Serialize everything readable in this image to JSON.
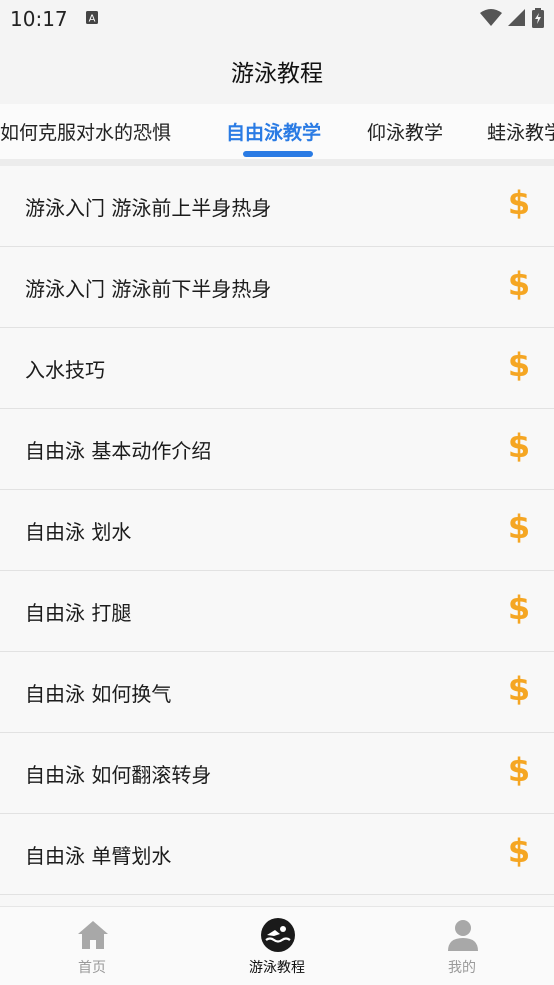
{
  "status_bar": {
    "time": "10:17",
    "icons": [
      "a-notification-icon",
      "wifi-icon",
      "signal-icon",
      "battery-charging-icon"
    ]
  },
  "header": {
    "title": "游泳教程"
  },
  "tabs": [
    {
      "label": "如何克服对水的恐惧",
      "active": false
    },
    {
      "label": "自由泳教学",
      "active": true
    },
    {
      "label": "仰泳教学",
      "active": false
    },
    {
      "label": "蛙泳教学",
      "active": false
    }
  ],
  "list": {
    "items": [
      {
        "title": "游泳入门 游泳前上半身热身",
        "icon": "dollar-icon"
      },
      {
        "title": "游泳入门 游泳前下半身热身",
        "icon": "dollar-icon"
      },
      {
        "title": "入水技巧",
        "icon": "dollar-icon"
      },
      {
        "title": "自由泳 基本动作介绍",
        "icon": "dollar-icon"
      },
      {
        "title": "自由泳 划水",
        "icon": "dollar-icon"
      },
      {
        "title": "自由泳 打腿",
        "icon": "dollar-icon"
      },
      {
        "title": "自由泳 如何换气",
        "icon": "dollar-icon"
      },
      {
        "title": "自由泳 如何翻滚转身",
        "icon": "dollar-icon"
      },
      {
        "title": "自由泳 单臂划水",
        "icon": "dollar-icon"
      }
    ]
  },
  "bottom_nav": [
    {
      "label": "首页",
      "icon": "home-icon",
      "active": false
    },
    {
      "label": "游泳教程",
      "icon": "swimmer-icon",
      "active": true
    },
    {
      "label": "我的",
      "icon": "profile-icon",
      "active": false
    }
  ],
  "colors": {
    "accent": "#2a7be4",
    "dollar": "#f5a623",
    "background": "#f4f4f4"
  }
}
